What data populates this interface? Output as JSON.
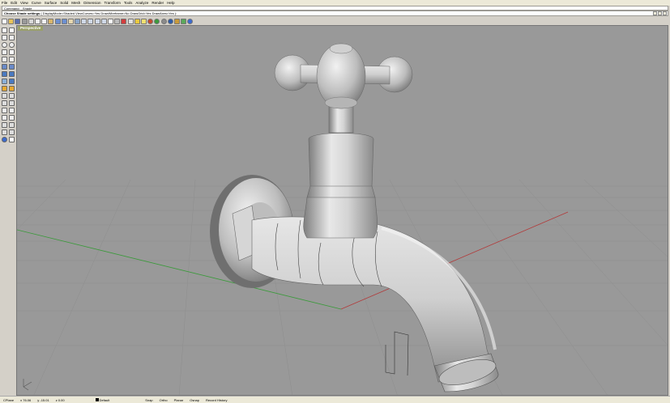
{
  "menu": [
    "File",
    "Edit",
    "View",
    "Curve",
    "Surface",
    "Solid",
    "Mesh",
    "Dimension",
    "Transform",
    "Tools",
    "Analyze",
    "Render",
    "Help"
  ],
  "command": {
    "history": "Command: _Shade",
    "prompt": "Choose Shade settings",
    "options": "( DisplayMode=Shaded  ViewCurves=Yes  DrawWireframe=No  DrawGrid=Yes  DrawAxes=Yes ):"
  },
  "viewport": {
    "label": "Perspective"
  },
  "status": {
    "cplane": "CPlane",
    "x": "x 76.06",
    "y": "y -15.01",
    "z": "z 0.00",
    "layer": "Default",
    "toggles": [
      "Snap",
      "Ortho",
      "Planar",
      "Osnap",
      "Record History"
    ]
  },
  "colors": {
    "viewport_bg": "#999999",
    "grid": "#8c8c8c",
    "x_axis": "#b23a3a",
    "y_axis": "#3a9a3a",
    "faucet": "#c8c8c8"
  },
  "toolbar_icons": [
    "new-icon",
    "open-icon",
    "save-icon",
    "print-icon",
    "import-icon",
    "cut-icon",
    "copy-icon",
    "paste-icon",
    "undo-icon",
    "redo-icon",
    "pan-icon",
    "rotate-icon",
    "zoom-icon",
    "zoom-window-icon",
    "zoom-extents-icon",
    "zoom-selected-icon",
    "four-view-icon",
    "grid-icon",
    "layer-icon",
    "properties-icon",
    "object-snap-icon",
    "light-icon",
    "shade-icon",
    "render-icon",
    "material-icon",
    "sphere-icon",
    "environment-icon",
    "options-icon",
    "help-icon"
  ]
}
